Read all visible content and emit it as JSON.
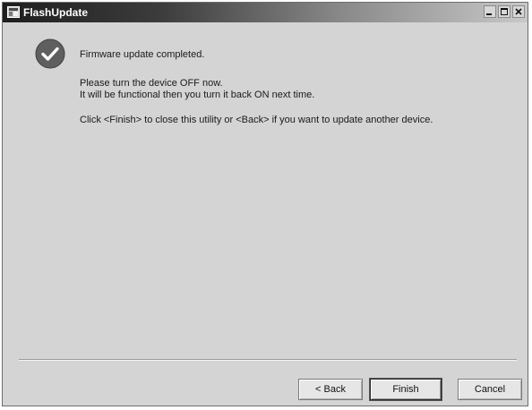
{
  "window": {
    "title": "FlashUpdate",
    "icons": {
      "app": "flash-app-icon",
      "minimize": "minimize-icon",
      "maximize": "maximize-icon",
      "close": "close-icon",
      "status": "check-circle-icon"
    }
  },
  "content": {
    "status_title": "Firmware update completed.",
    "line_turn_off": "Please turn the device OFF now.",
    "line_functional": "It will be functional then you turn it back ON next time.",
    "line_instructions": "Click <Finish> to close this utility or <Back> if you want to update another device."
  },
  "buttons": {
    "back": "< Back",
    "finish": "Finish",
    "cancel": "Cancel"
  },
  "colors": {
    "window_bg": "#d4d4d4",
    "titlebar_dark": "#1e1e1e",
    "check_circle": "#6a6a6a"
  }
}
